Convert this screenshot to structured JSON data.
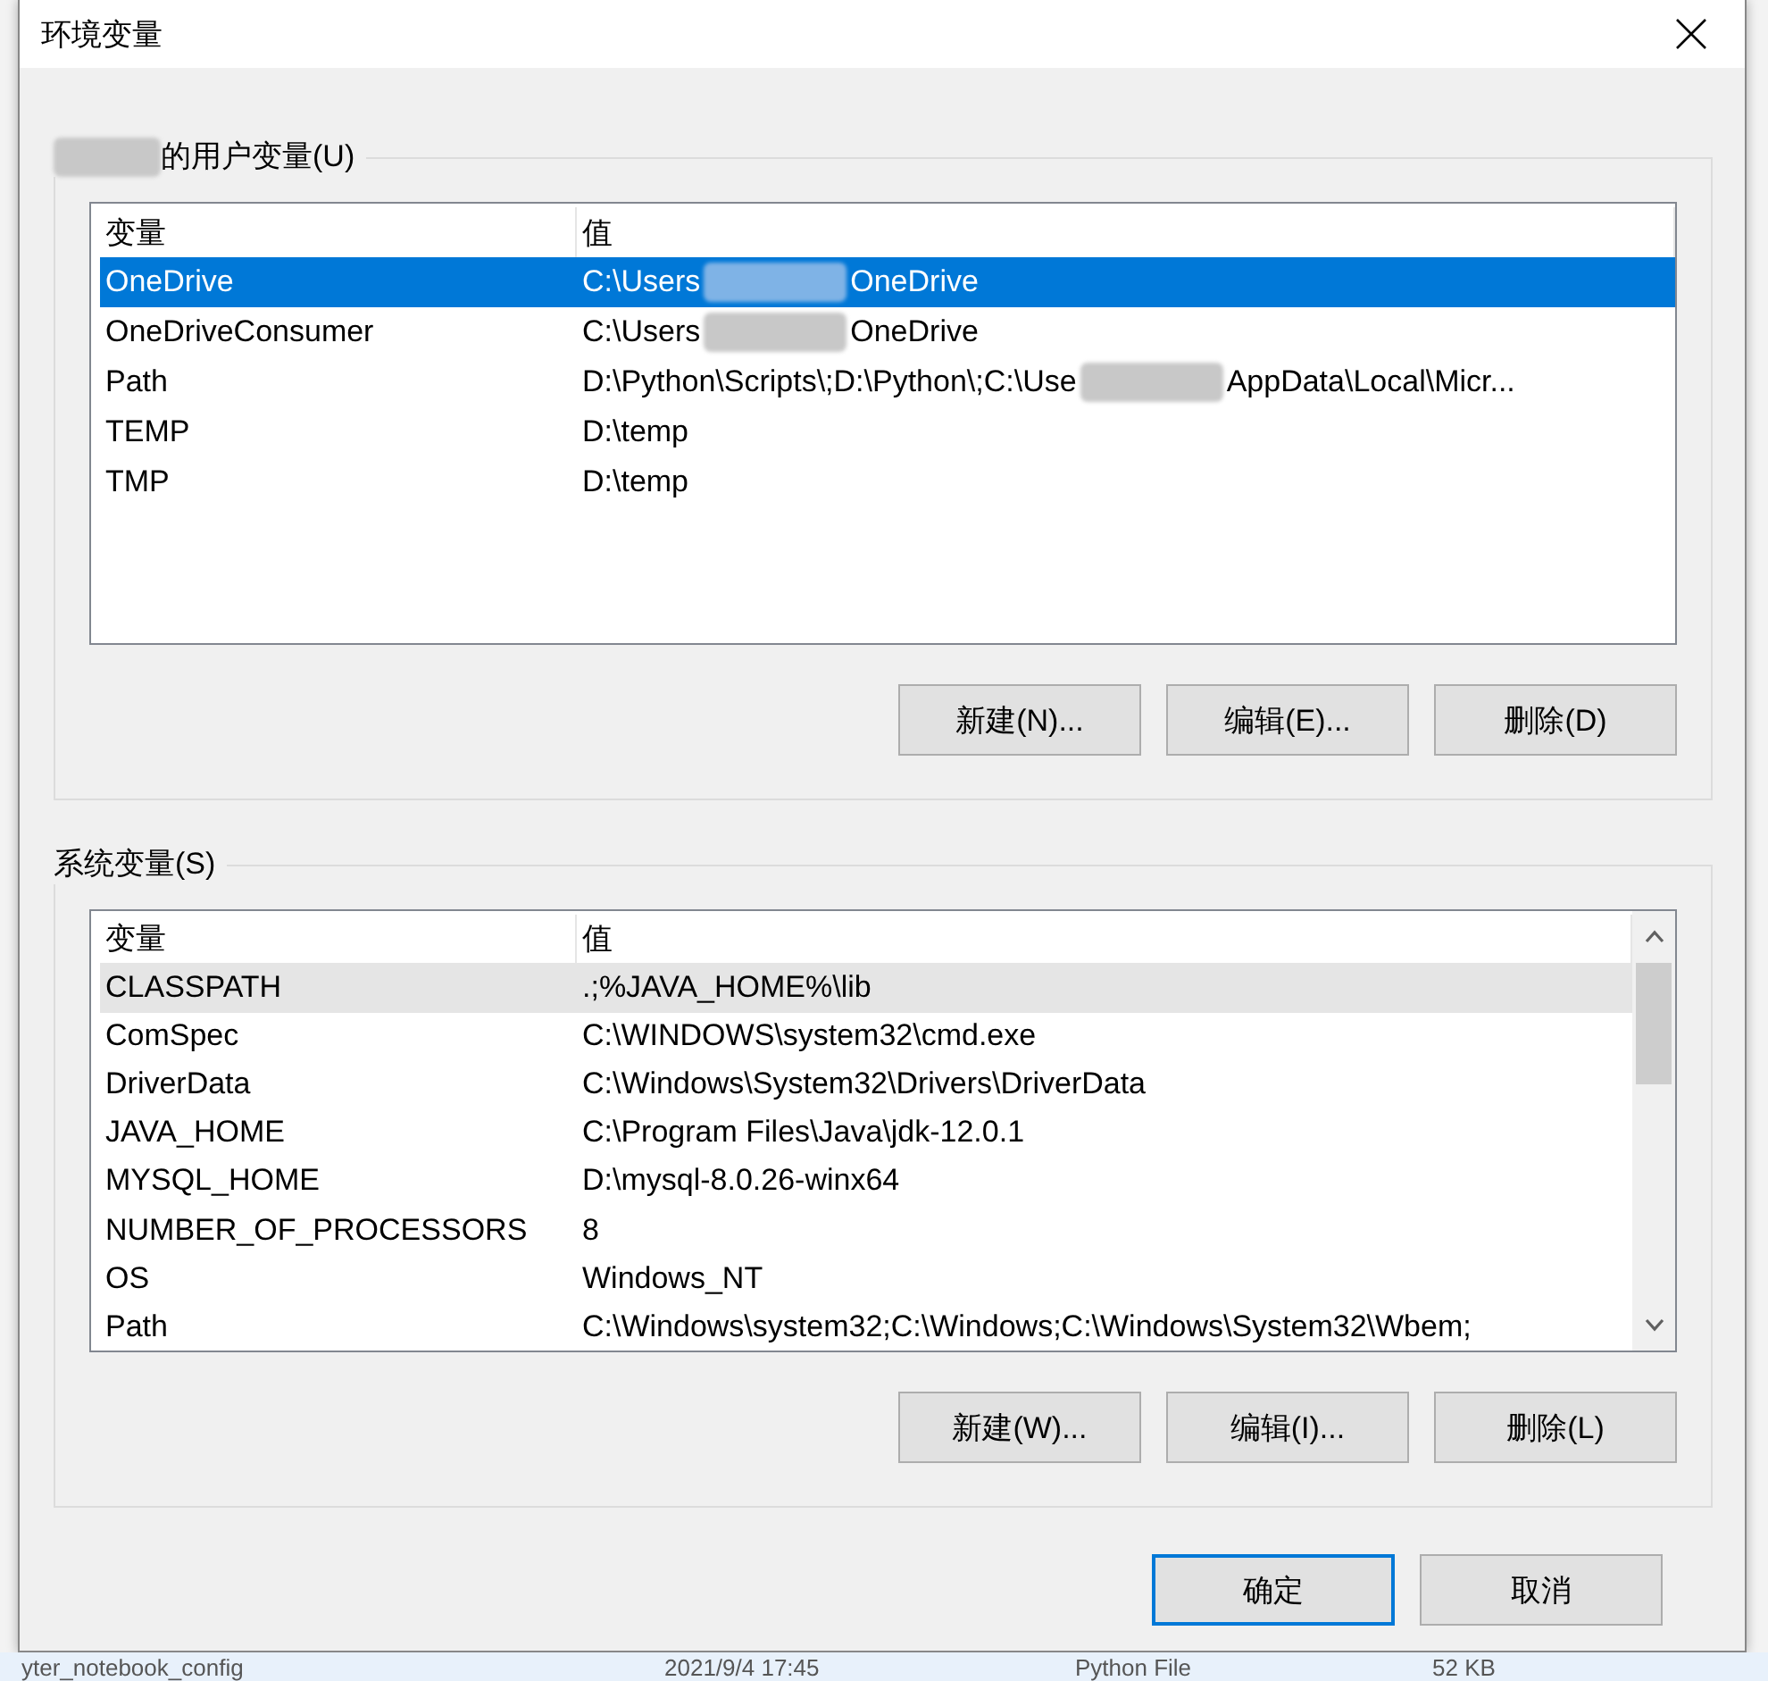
{
  "window": {
    "title": "环境变量"
  },
  "user_group": {
    "owner_redacted": true,
    "title": "的用户变量(U)",
    "columns": [
      "变量",
      "值"
    ],
    "rows": [
      {
        "name": "OneDrive",
        "value_parts": [
          "C:\\Users",
          "OneDrive"
        ],
        "selected": true,
        "highlighted": false
      },
      {
        "name": "OneDriveConsumer",
        "value_parts": [
          "C:\\Users",
          "OneDrive"
        ],
        "selected": false,
        "highlighted": false
      },
      {
        "name": "Path",
        "value_parts": [
          "D:\\Python\\Scripts\\;D:\\Python\\;C:\\Use",
          "AppData\\Local\\Micr..."
        ],
        "selected": false,
        "highlighted": false
      },
      {
        "name": "TEMP",
        "value_parts": [
          "D:\\temp"
        ],
        "selected": false,
        "highlighted": false
      },
      {
        "name": "TMP",
        "value_parts": [
          "D:\\temp"
        ],
        "selected": false,
        "highlighted": false
      }
    ],
    "buttons": [
      "新建(N)...",
      "编辑(E)...",
      "删除(D)"
    ]
  },
  "system_group": {
    "title": "系统变量(S)",
    "columns": [
      "变量",
      "值"
    ],
    "rows": [
      {
        "name": "CLASSPATH",
        "value_parts": [
          ".;%JAVA_HOME%\\lib"
        ],
        "selected": false,
        "highlighted": true
      },
      {
        "name": "ComSpec",
        "value_parts": [
          "C:\\WINDOWS\\system32\\cmd.exe"
        ],
        "selected": false,
        "highlighted": false
      },
      {
        "name": "DriverData",
        "value_parts": [
          "C:\\Windows\\System32\\Drivers\\DriverData"
        ],
        "selected": false,
        "highlighted": false
      },
      {
        "name": "JAVA_HOME",
        "value_parts": [
          "C:\\Program Files\\Java\\jdk-12.0.1"
        ],
        "selected": false,
        "highlighted": false
      },
      {
        "name": "MYSQL_HOME",
        "value_parts": [
          "D:\\mysql-8.0.26-winx64"
        ],
        "selected": false,
        "highlighted": false
      },
      {
        "name": "NUMBER_OF_PROCESSORS",
        "value_parts": [
          "8"
        ],
        "selected": false,
        "highlighted": false
      },
      {
        "name": "OS",
        "value_parts": [
          "Windows_NT"
        ],
        "selected": false,
        "highlighted": false
      },
      {
        "name": "Path",
        "value_parts": [
          "C:\\Windows\\system32;C:\\Windows;C:\\Windows\\System32\\Wbem;"
        ],
        "selected": false,
        "highlighted": false
      }
    ],
    "buttons": [
      "新建(W)...",
      "编辑(I)...",
      "删除(L)"
    ]
  },
  "footer_buttons": [
    {
      "label": "确定",
      "default": true
    },
    {
      "label": "取消",
      "default": false
    }
  ],
  "background_row": [
    "yter_notebook_config",
    "2021/9/4 17:45",
    "Python File",
    "52 KB"
  ]
}
